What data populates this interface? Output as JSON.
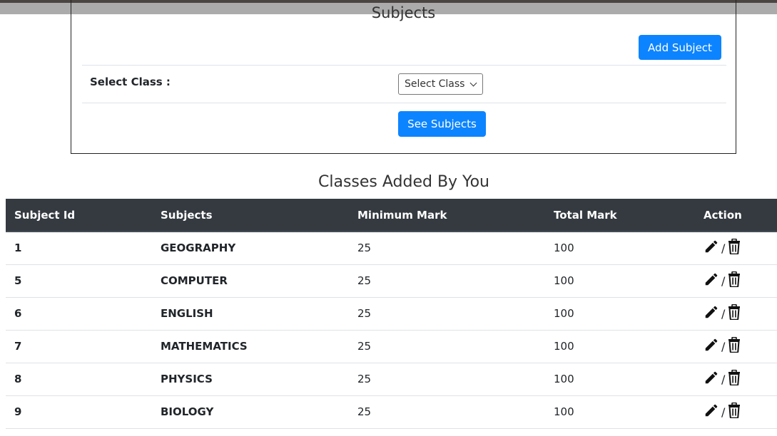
{
  "card": {
    "title": "Subjects",
    "add_subject_label": "Add Subject",
    "select_class_label": "Select Class :",
    "select_class_value": "Select Class",
    "see_subjects_label": "See Subjects"
  },
  "section_title": "Classes Added By You",
  "table": {
    "headers": [
      "Subject Id",
      "Subjects",
      "Minimum Mark",
      "Total Mark",
      "Action"
    ],
    "rows": [
      {
        "id": "1",
        "subject": "GEOGRAPHY",
        "min": "25",
        "total": "100"
      },
      {
        "id": "5",
        "subject": "COMPUTER",
        "min": "25",
        "total": "100"
      },
      {
        "id": "6",
        "subject": "ENGLISH",
        "min": "25",
        "total": "100"
      },
      {
        "id": "7",
        "subject": "MATHEMATICS",
        "min": "25",
        "total": "100"
      },
      {
        "id": "8",
        "subject": "PHYSICS",
        "min": "25",
        "total": "100"
      },
      {
        "id": "9",
        "subject": "BIOLOGY",
        "min": "25",
        "total": "100"
      }
    ],
    "action_separator": "/",
    "edit_icon": "pencil-icon",
    "delete_icon": "trash-icon"
  },
  "colors": {
    "primary": "#0d84ff",
    "table_header_bg": "#343a40"
  }
}
